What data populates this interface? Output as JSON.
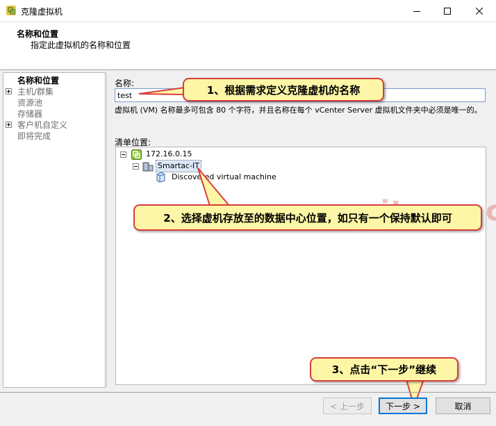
{
  "window": {
    "title": "克隆虚拟机"
  },
  "header": {
    "title": "名称和位置",
    "subtitle": "指定此虚拟机的名称和位置"
  },
  "nav": {
    "items": [
      {
        "label": "名称和位置",
        "expander": "none",
        "state": "selected"
      },
      {
        "label": "主机/群集",
        "expander": "plus",
        "state": "disabled"
      },
      {
        "label": "资源池",
        "expander": "none",
        "state": "disabled"
      },
      {
        "label": "存储器",
        "expander": "none",
        "state": "disabled"
      },
      {
        "label": "客户机自定义",
        "expander": "plus",
        "state": "disabled"
      },
      {
        "label": "即将完成",
        "expander": "none",
        "state": "disabled"
      }
    ]
  },
  "form": {
    "name_label": "名称:",
    "name_value": "test",
    "note": "虚拟机 (VM) 名称最多可包含 80 个字符，并且名称在每个 vCenter Server 虚拟机文件夹中必须是唯一的。",
    "inventory_label": "清单位置:"
  },
  "tree": {
    "root": "172.16.0.15",
    "datacenter": "Smartac-IT",
    "folder": "Discovered virtual machine"
  },
  "annotations": {
    "step1": "1、根据需求定义克隆虚机的名称",
    "step2": "2、选择虚机存放至的数据中心位置，如只有一个保持默认即可",
    "step3": "3、点击“下一步”继续",
    "watermark": "www.ityww.cn"
  },
  "buttons": {
    "back": "< 上一步",
    "next": "下一步 >",
    "cancel": "取消"
  },
  "colors": {
    "callout_bg": "#fcf6a6",
    "callout_border": "#d93d3d",
    "default_button_border": "#0078d7"
  }
}
